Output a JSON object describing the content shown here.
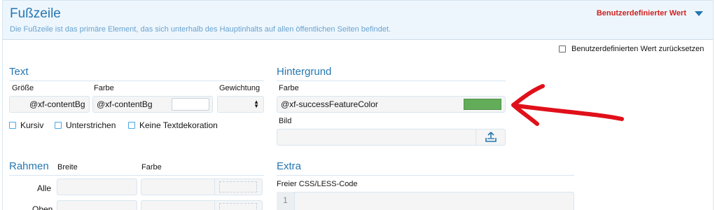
{
  "header": {
    "title": "Fußzeile",
    "description": "Die Fußzeile ist das primäre Element, das sich unterhalb des Hauptinhalts auf allen öffentlichen Seiten befindet.",
    "custom_value_label": "Benutzerdefinierter Wert"
  },
  "reset": {
    "label": "Benutzerdefinierten Wert zurücksetzen",
    "checked": false
  },
  "text_section": {
    "title": "Text",
    "size_label": "Größe",
    "size_value": "@xf-contentBg",
    "color_label": "Farbe",
    "color_value": "@xf-contentBg",
    "weight_label": "Gewichtung",
    "options": [
      {
        "label": "Kursiv",
        "checked": false
      },
      {
        "label": "Unterstrichen",
        "checked": false
      },
      {
        "label": "Keine Textdekoration",
        "checked": false
      }
    ]
  },
  "background_section": {
    "title": "Hintergrund",
    "color_label": "Farbe",
    "color_value": "@xf-successFeatureColor",
    "swatch_color": "#63ac5a",
    "image_label": "Bild",
    "image_value": ""
  },
  "border_section": {
    "title": "Rahmen",
    "width_label": "Breite",
    "color_label": "Farbe",
    "rows": [
      {
        "label": "Alle"
      },
      {
        "label": "Oben"
      }
    ]
  },
  "extra_section": {
    "title": "Extra",
    "css_label": "Freier CSS/LESS-Code",
    "line_number": "1"
  },
  "colors": {
    "accent": "#2577b1",
    "warning": "#d0221f",
    "annotation": "#e0101a"
  },
  "icons": {
    "dropdown": "caret-down-icon",
    "upload": "upload-icon"
  }
}
